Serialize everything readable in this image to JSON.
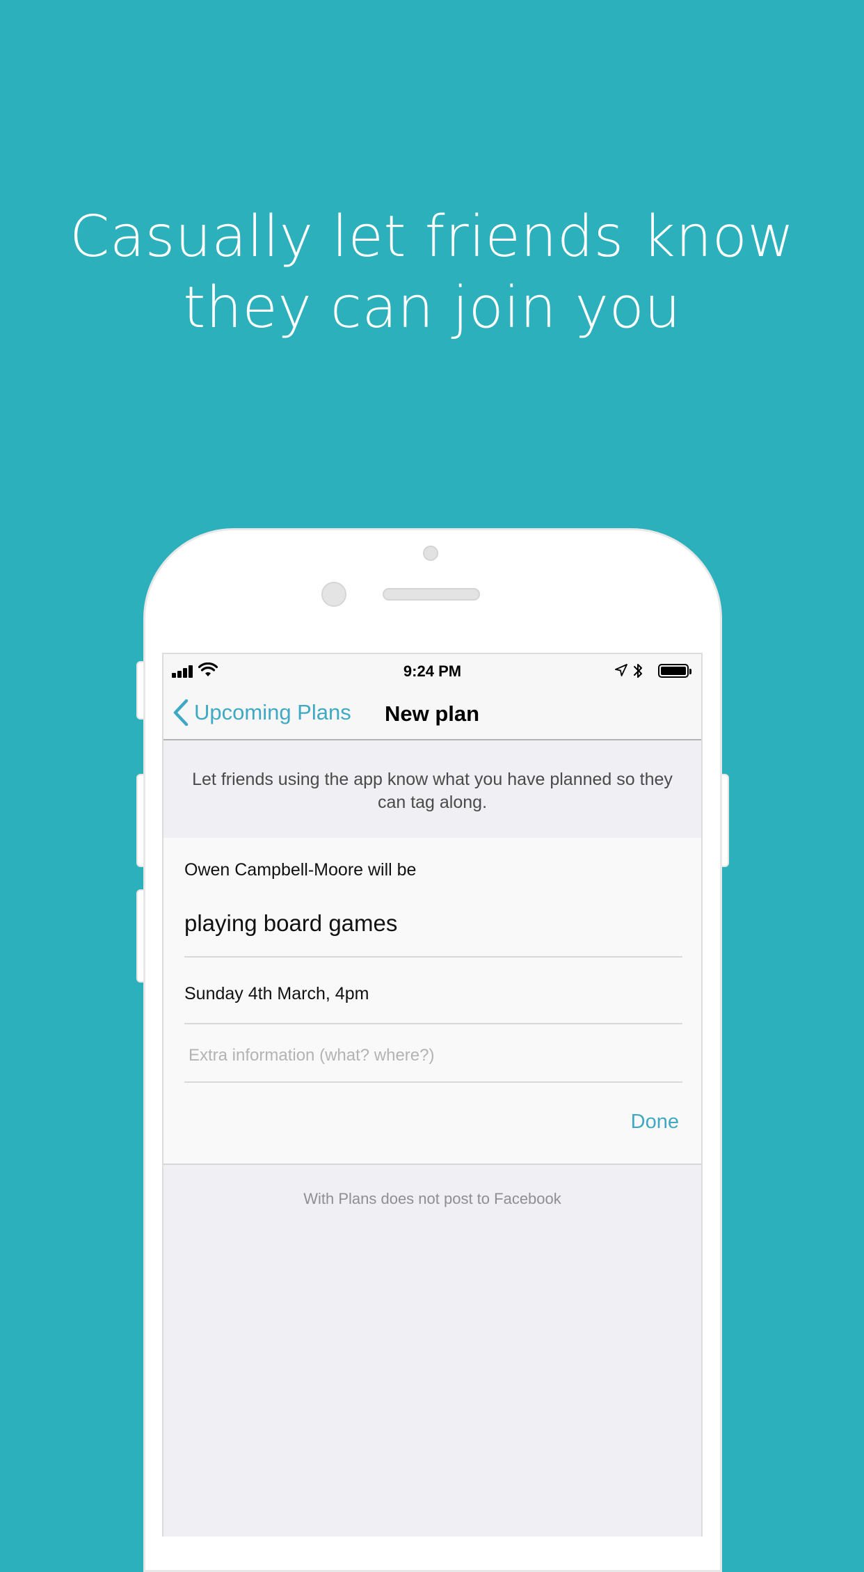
{
  "headline": {
    "line1": "Casually let friends know",
    "line2": "they can join you"
  },
  "status_bar": {
    "time": "9:24 PM",
    "icons": [
      "signal-icon",
      "wifi-icon",
      "location-arrow-icon",
      "bluetooth-icon",
      "battery-icon"
    ],
    "battery_level": 1.0
  },
  "nav": {
    "back_label": "Upcoming Plans",
    "title": "New plan"
  },
  "intro": {
    "text": "Let friends using the app know what you have planned so they can tag along."
  },
  "form": {
    "person_label": "Owen Campbell-Moore will be",
    "activity": "playing board games",
    "date": "Sunday 4th March, 4pm",
    "extra_placeholder": "Extra information (what? where?)",
    "extra_value": "",
    "done_label": "Done"
  },
  "footer": {
    "note": "With Plans does not post to Facebook"
  },
  "colors": {
    "background": "#2cb0bb",
    "accent": "#3fa9c4",
    "screen_bg": "#efeff4",
    "card_bg": "#f9f9f9"
  }
}
